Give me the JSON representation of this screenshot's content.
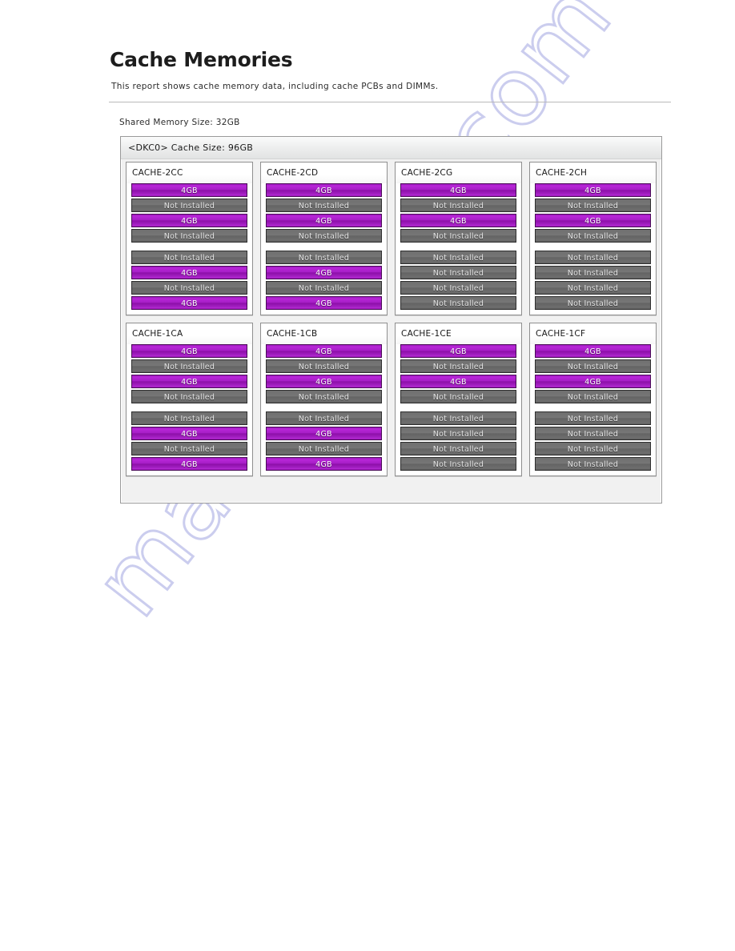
{
  "document": {
    "title": "Cache Memories",
    "description": "This report shows cache memory data, including cache PCBs and DIMMs.",
    "shared_memory": "Shared Memory Size: 32GB",
    "watermark": "manualslib.com"
  },
  "colors": {
    "installed": "#a61ec6",
    "empty": "#6e6e6e",
    "frame_border": "#9a9a9a",
    "watermark": "#c9cbee"
  },
  "labels": {
    "installed": "4GB",
    "empty": "Not Installed"
  },
  "dkc": {
    "header": "<DKC0> Cache Size: 96GB",
    "rows": [
      {
        "panels": [
          {
            "title": "CACHE-2CC",
            "groups": [
              [
                "4GB",
                "Not Installed",
                "4GB",
                "Not Installed"
              ],
              [
                "Not Installed",
                "4GB",
                "Not Installed",
                "4GB"
              ]
            ]
          },
          {
            "title": "CACHE-2CD",
            "groups": [
              [
                "4GB",
                "Not Installed",
                "4GB",
                "Not Installed"
              ],
              [
                "Not Installed",
                "4GB",
                "Not Installed",
                "4GB"
              ]
            ]
          },
          {
            "title": "CACHE-2CG",
            "groups": [
              [
                "4GB",
                "Not Installed",
                "4GB",
                "Not Installed"
              ],
              [
                "Not Installed",
                "Not Installed",
                "Not Installed",
                "Not Installed"
              ]
            ]
          },
          {
            "title": "CACHE-2CH",
            "groups": [
              [
                "4GB",
                "Not Installed",
                "4GB",
                "Not Installed"
              ],
              [
                "Not Installed",
                "Not Installed",
                "Not Installed",
                "Not Installed"
              ]
            ]
          }
        ]
      },
      {
        "panels": [
          {
            "title": "CACHE-1CA",
            "groups": [
              [
                "4GB",
                "Not Installed",
                "4GB",
                "Not Installed"
              ],
              [
                "Not Installed",
                "4GB",
                "Not Installed",
                "4GB"
              ]
            ]
          },
          {
            "title": "CACHE-1CB",
            "groups": [
              [
                "4GB",
                "Not Installed",
                "4GB",
                "Not Installed"
              ],
              [
                "Not Installed",
                "4GB",
                "Not Installed",
                "4GB"
              ]
            ]
          },
          {
            "title": "CACHE-1CE",
            "groups": [
              [
                "4GB",
                "Not Installed",
                "4GB",
                "Not Installed"
              ],
              [
                "Not Installed",
                "Not Installed",
                "Not Installed",
                "Not Installed"
              ]
            ]
          },
          {
            "title": "CACHE-1CF",
            "groups": [
              [
                "4GB",
                "Not Installed",
                "4GB",
                "Not Installed"
              ],
              [
                "Not Installed",
                "Not Installed",
                "Not Installed",
                "Not Installed"
              ]
            ]
          }
        ]
      }
    ]
  }
}
